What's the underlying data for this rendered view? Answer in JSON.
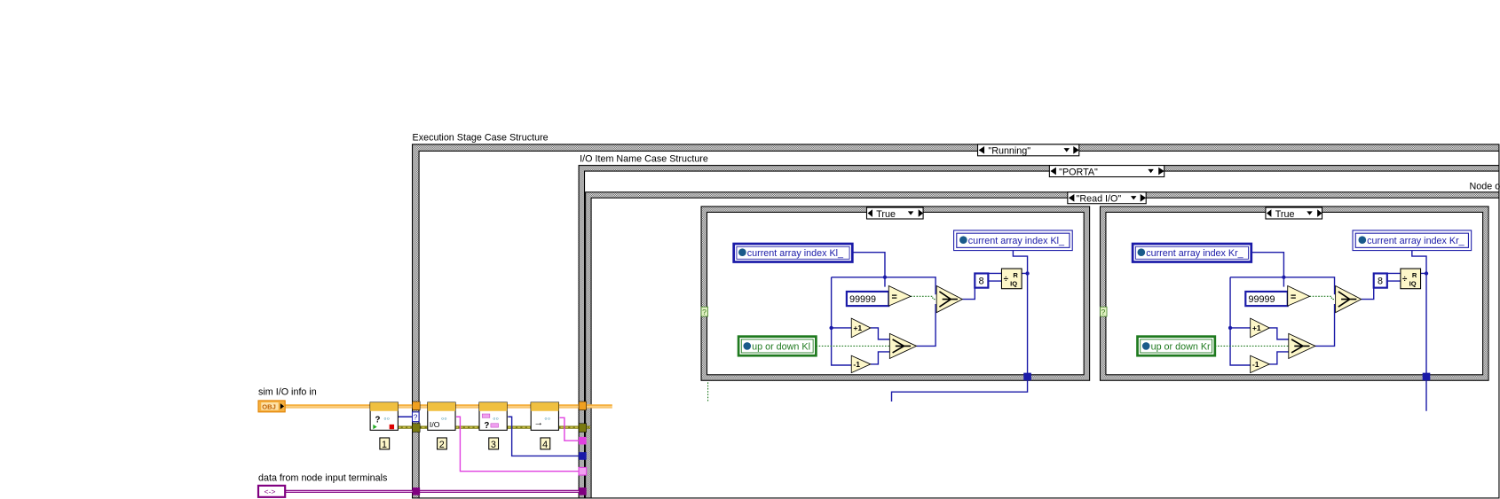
{
  "structures": {
    "execution_stage": {
      "label": "Execution Stage Case Structure",
      "selector": "\"Running\""
    },
    "io_item_name": {
      "label": "I/O Item Name Case Structure",
      "selector": "\"PORTA\""
    },
    "node_label": "Node o",
    "read_io": {
      "selector": "\"Read I/O\""
    },
    "left_case": {
      "selector": "True",
      "read_global": "current array index Kl_",
      "write_global": "current array index Kl_",
      "direction_global": "up or down Kl",
      "constant_limit": "99999",
      "constant_divisor": "8",
      "increment": "+1",
      "decrement": "-1",
      "equal_op": "=",
      "quotient_r": "R",
      "quotient_iq": "IQ",
      "selector_terminal": "?"
    },
    "right_case": {
      "selector": "True",
      "read_global": "current array index Kr_",
      "write_global": "current array index Kr_",
      "direction_global": "up or down Kr",
      "constant_limit": "99999",
      "constant_divisor": "8",
      "increment": "+1",
      "decrement": "-1",
      "equal_op": "=",
      "quotient_r": "R",
      "quotient_iq": "IQ",
      "selector_terminal": "?"
    }
  },
  "inputs": {
    "sim_io_label": "sim I/O info in",
    "sim_io_terminal": "OBJ",
    "node_input_label": "data from node input terminals",
    "node_input_terminal": "<->"
  },
  "subvis": [
    {
      "index": "1",
      "glyph": "?"
    },
    {
      "index": "2",
      "glyph": "I/O"
    },
    {
      "index": "3",
      "glyph": "?"
    },
    {
      "index": "4",
      "glyph": "→"
    }
  ],
  "tunnel_glyph": "?",
  "colors": {
    "wire_numeric": "#1a1aa8",
    "wire_object": "#f0a020",
    "wire_cluster": "#7a7a10",
    "wire_string": "#e040e0",
    "wire_variant": "#800080",
    "global_border": "#1a1aa8",
    "global_green": "#1f7a1f"
  }
}
